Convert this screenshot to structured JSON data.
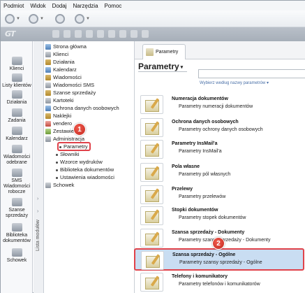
{
  "menu": [
    "Podmiot",
    "Widok",
    "Dodaj",
    "Narzędzia",
    "Pomoc"
  ],
  "logo": "GT",
  "rail": [
    {
      "label": "Klienci",
      "icon": "clients-icon"
    },
    {
      "label": "Listy klientów",
      "icon": "client-lists-icon"
    },
    {
      "label": "Działania",
      "icon": "actions-icon"
    },
    {
      "label": "Zadania",
      "icon": "tasks-icon"
    },
    {
      "label": "Kalendarz",
      "icon": "calendar-icon"
    },
    {
      "label": "Wiadomości odebrane",
      "icon": "inbox-icon"
    },
    {
      "label": "SMS Wiadomości robocze",
      "icon": "sms-drafts-icon"
    },
    {
      "label": "Szanse sprzedaży",
      "icon": "sales-opportunities-icon"
    },
    {
      "label": "Biblioteka dokumentów",
      "icon": "document-library-icon"
    },
    {
      "label": "Schowek",
      "icon": "clipboard-icon"
    }
  ],
  "vertical_label": "Lista modułów",
  "tree": {
    "items": [
      "Strona główna",
      "Klienci",
      "Działania",
      "Kalendarz",
      "Wiadomości",
      "Wiadomości SMS",
      "Szanse sprzedaży",
      "Kartoteki",
      "Ochrona danych osobowych",
      "Naklejki",
      "vendero",
      "Zestawienia",
      "Administracja"
    ],
    "sub_items": [
      "Parametry",
      "Słowniki",
      "Wzorce wydruków",
      "Biblioteka dokumentów",
      "Ustawienia wiadomości"
    ],
    "last": "Schowek"
  },
  "tab": {
    "label": "Parametry"
  },
  "page": {
    "title": "Parametry",
    "search_link": "Wybierz według nazwy parametrów"
  },
  "params": [
    {
      "title": "Numeracja dokumentów",
      "desc": "Parametry numeracji dokumentów"
    },
    {
      "title": "Ochrona danych osobowych",
      "desc": "Parametry ochrony danych osobowych"
    },
    {
      "title": "Parametry InsMail'a",
      "desc": "Parametry InsMail'a"
    },
    {
      "title": "Pola własne",
      "desc": "Parametry pól własnych"
    },
    {
      "title": "Przelewy",
      "desc": "Parametry przelewów"
    },
    {
      "title": "Stopki dokumentów",
      "desc": "Parametry stopek dokumentów"
    },
    {
      "title": "Szansa sprzedaży - Dokumenty",
      "desc": "Parametry szansy sprzedaży - Dokumenty"
    },
    {
      "title": "Szansa sprzedaży - Ogólne",
      "desc": "Parametry szansy sprzedaży - Ogólne"
    },
    {
      "title": "Telefony i komunikatory",
      "desc": "Parametry telefonów i komunikatorów"
    }
  ],
  "badges": [
    "1",
    "2"
  ],
  "colors": {
    "highlight": "#e0424a",
    "selected_row": "#c9ddf2",
    "link": "#4a70a8"
  }
}
